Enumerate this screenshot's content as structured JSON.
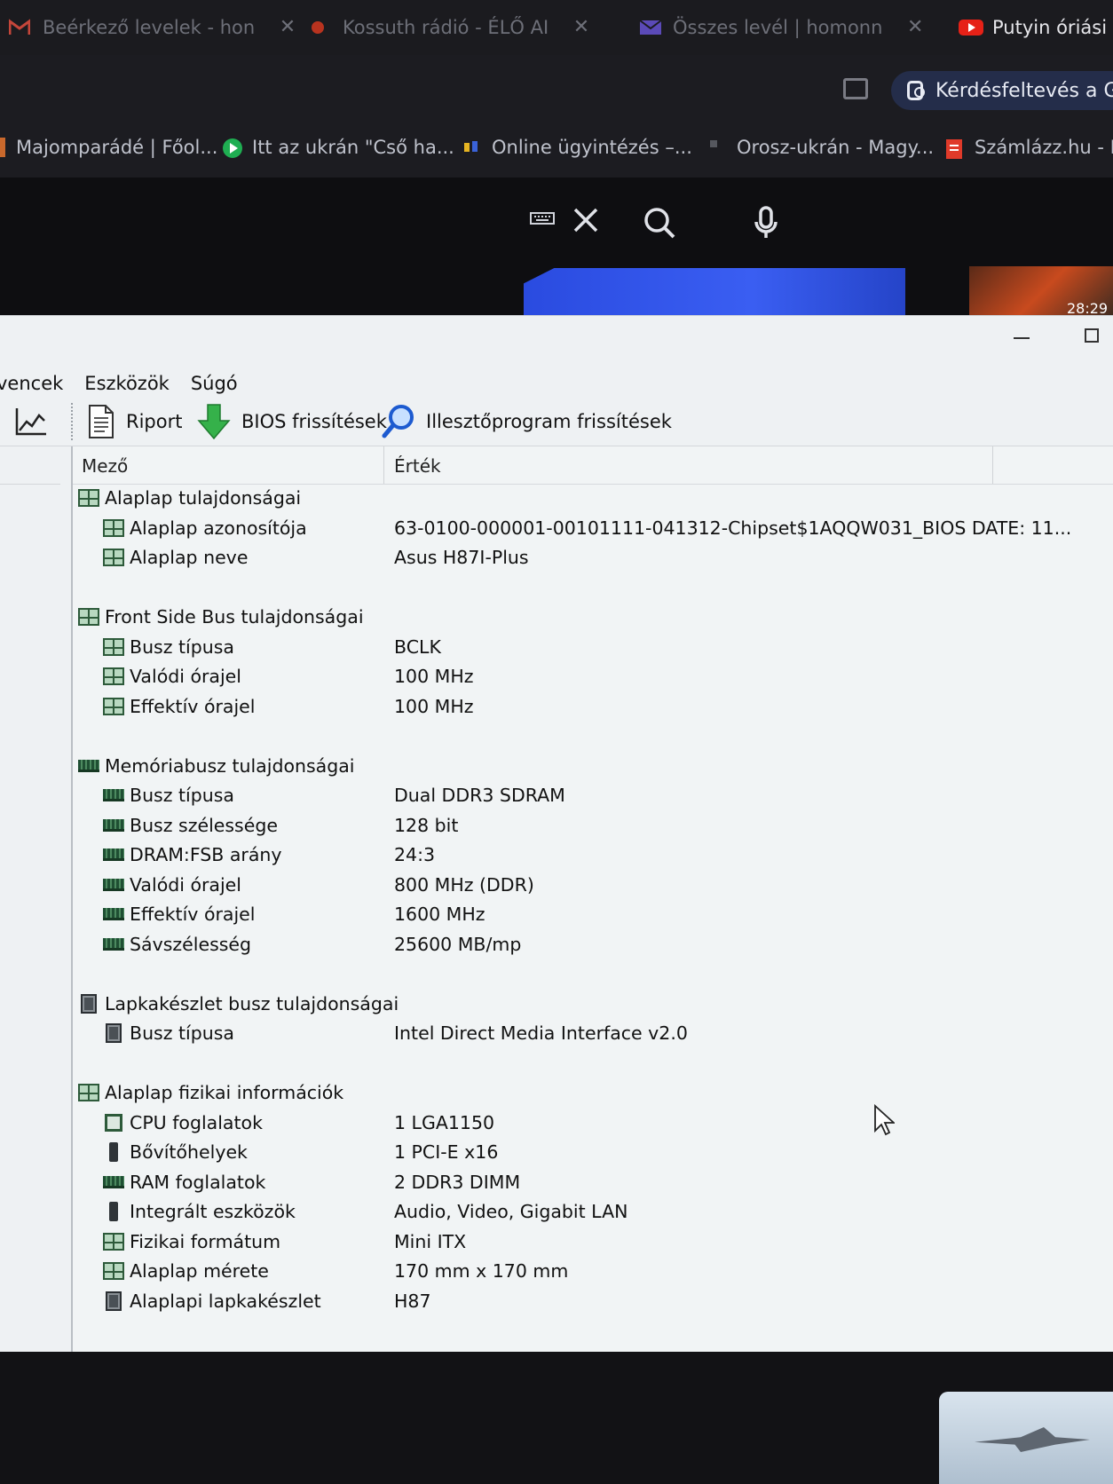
{
  "browser": {
    "tabs": [
      {
        "title": "Beérkező levelek - hon",
        "icon": "gmail-icon"
      },
      {
        "title": "Kossuth rádió - ÉLŐ AI",
        "icon": "radio-icon"
      },
      {
        "title": "Összes levél | homonn",
        "icon": "gmail-icon"
      },
      {
        "title": "Putyin óriási c",
        "icon": "youtube-icon"
      }
    ],
    "lens_button": "Kérdésfeltevés a Go",
    "bookmarks": [
      {
        "label": "Majomparádé | Főol...",
        "icon": "bookmark-icon"
      },
      {
        "label": "Itt az ukrán \"Cső ha...",
        "icon": "play-icon"
      },
      {
        "label": "Online ügyintézés –...",
        "icon": "bookmark-icon"
      },
      {
        "label": "Orosz-ukrán - Magy...",
        "icon": "bookmark-icon"
      },
      {
        "label": "Számlázz.hu - Ki",
        "icon": "invoice-icon"
      }
    ],
    "video_time": "28:29"
  },
  "menu": [
    "vencek",
    "Eszközök",
    "Súgó"
  ],
  "toolbar": {
    "report": "Riport",
    "bios_update": "BIOS frissítések",
    "driver_update": "Illesztőprogram frissítések"
  },
  "columns": {
    "field": "Mező",
    "value": "Érték"
  },
  "groups": [
    {
      "title": "Alaplap tulajdonságai",
      "icon": "board",
      "rows": [
        {
          "field": "Alaplap azonosítója",
          "value": "63-0100-000001-00101111-041312-Chipset$1AQQW031_BIOS DATE: 11...",
          "icon": "board"
        },
        {
          "field": "Alaplap neve",
          "value": "Asus H87I-Plus",
          "icon": "board"
        }
      ]
    },
    {
      "title": "Front Side Bus tulajdonságai",
      "icon": "board",
      "rows": [
        {
          "field": "Busz típusa",
          "value": "BCLK",
          "icon": "board"
        },
        {
          "field": "Valódi órajel",
          "value": "100 MHz",
          "icon": "board"
        },
        {
          "field": "Effektív órajel",
          "value": "100 MHz",
          "icon": "board"
        }
      ]
    },
    {
      "title": "Memóriabusz tulajdonságai",
      "icon": "ram",
      "rows": [
        {
          "field": "Busz típusa",
          "value": "Dual DDR3 SDRAM",
          "icon": "ram"
        },
        {
          "field": "Busz szélessége",
          "value": "128 bit",
          "icon": "ram"
        },
        {
          "field": "DRAM:FSB arány",
          "value": "24:3",
          "icon": "ram"
        },
        {
          "field": "Valódi órajel",
          "value": "800 MHz (DDR)",
          "icon": "ram"
        },
        {
          "field": "Effektív órajel",
          "value": "1600 MHz",
          "icon": "ram"
        },
        {
          "field": "Sávszélesség",
          "value": "25600 MB/mp",
          "icon": "ram"
        }
      ]
    },
    {
      "title": "Lapkakészlet busz tulajdonságai",
      "icon": "chip",
      "rows": [
        {
          "field": "Busz típusa",
          "value": "Intel Direct Media Interface v2.0",
          "icon": "chip"
        }
      ]
    },
    {
      "title": "Alaplap fizikai információk",
      "icon": "board",
      "rows": [
        {
          "field": "CPU foglalatok",
          "value": "1 LGA1150",
          "icon": "cpu"
        },
        {
          "field": "Bővítőhelyek",
          "value": "1 PCI-E x16",
          "icon": "slot"
        },
        {
          "field": "RAM foglalatok",
          "value": "2 DDR3 DIMM",
          "icon": "ram"
        },
        {
          "field": "Integrált eszközök",
          "value": "Audio, Video, Gigabit LAN",
          "icon": "slot"
        },
        {
          "field": "Fizikai formátum",
          "value": "Mini ITX",
          "icon": "board"
        },
        {
          "field": "Alaplap mérete",
          "value": "170 mm x 170 mm",
          "icon": "board"
        },
        {
          "field": "Alaplapi lapkakészlet",
          "value": "H87",
          "icon": "chip"
        }
      ]
    }
  ]
}
